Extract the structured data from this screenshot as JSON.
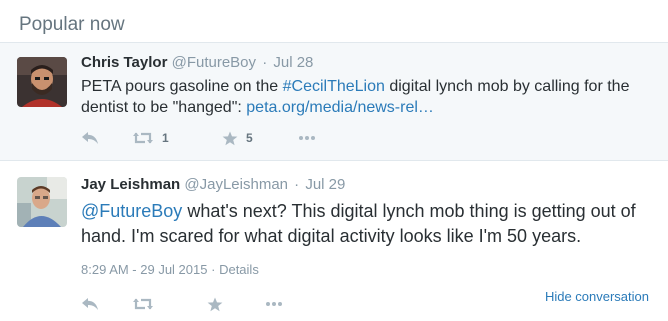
{
  "header": {
    "title": "Popular now"
  },
  "tweets": [
    {
      "name": "Chris Taylor",
      "handle": "@FutureBoy",
      "separator": "·",
      "time": "Jul 28",
      "text_before": "PETA pours gasoline on the ",
      "hashtag": "#CecilTheLion",
      "text_middle": " digital lynch mob by calling for the dentist to be \"hanged\": ",
      "link": "peta.org/media/news-rel…",
      "retweet_count": "1",
      "favorite_count": "5"
    },
    {
      "name": "Jay Leishman",
      "handle": "@JayLeishman",
      "separator": "·",
      "time": "Jul 29",
      "mention": "@FutureBoy",
      "text": " what's next? This digital lynch mob thing is getting out of hand. I'm scared for what digital activity looks like I'm 50 years.",
      "timestamp": "8:29 AM - 29 Jul 2015",
      "details_sep": "·",
      "details": "Details",
      "hide_conversation": "Hide conversation"
    }
  ],
  "icons": [
    "reply-icon",
    "retweet-icon",
    "favorite-icon",
    "more-icon"
  ],
  "colors": {
    "accent": "#2b7bb9",
    "muted": "#8899a6",
    "highlight_bg": "#f5f8fa"
  }
}
